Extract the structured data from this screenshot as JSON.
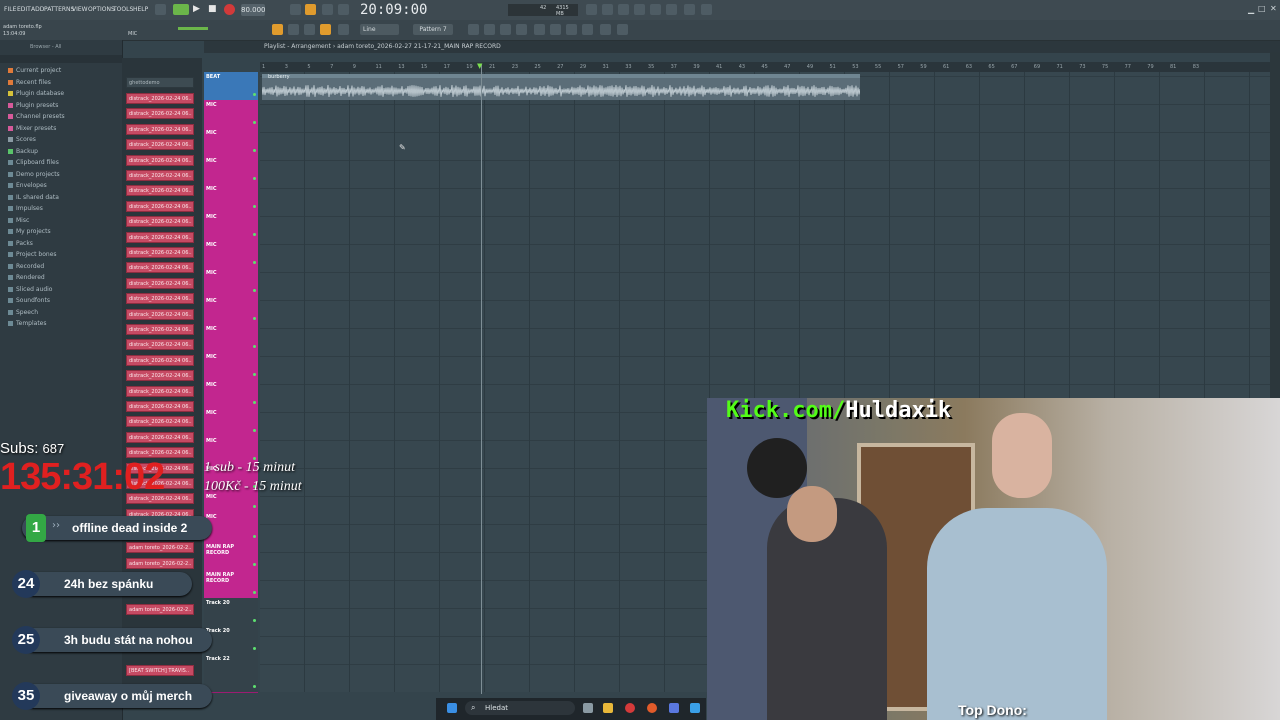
{
  "menu": [
    "FILE",
    "EDIT",
    "ADD",
    "PATTERNS",
    "VIEW",
    "OPTIONS",
    "TOOLS",
    "HELP"
  ],
  "transport": {
    "tempo": "80.000",
    "clock": "20:09:00",
    "pattern": "Pattern 7",
    "line_mode": "Line",
    "mic_label": "MIC",
    "cpu": "42",
    "mem": "4315 MB"
  },
  "project": {
    "name": "adam toreto.flp",
    "time": "13:04:09"
  },
  "browser": {
    "header": "Browser - All",
    "items": [
      "Current project",
      "Recent files",
      "Plugin database",
      "Plugin presets",
      "Channel presets",
      "Mixer presets",
      "Scores",
      "Backup",
      "Clipboard files",
      "Demo projects",
      "Envelopes",
      "IL shared data",
      "Impulses",
      "Misc",
      "My projects",
      "Packs",
      "Project bones",
      "Recorded",
      "Rendered",
      "Sliced audio",
      "Soundfonts",
      "Speech",
      "Templates"
    ]
  },
  "channels": {
    "first": "ghettodemo",
    "clip_label": "distrack_2026-02-24 06..",
    "bottom": [
      "adam toreto_2026-02-2..",
      "adam toreto_2026-02-2..",
      "adam toreto_2026-02-2..",
      "[BEAT SWITCH] TRAVIS.."
    ]
  },
  "playlist": {
    "title": "Playlist - Arrangement › adam toreto_2026-02-27 21-17-21_MAIN RAP RECORD",
    "clip_label": "burberry",
    "ruler": [
      "1",
      "3",
      "5",
      "7",
      "9",
      "11",
      "13",
      "15",
      "17",
      "19",
      "21",
      "23",
      "25",
      "27",
      "29",
      "31",
      "33",
      "35",
      "37",
      "39",
      "41",
      "43",
      "45",
      "47",
      "49",
      "51",
      "53",
      "55",
      "57",
      "59",
      "61",
      "63",
      "65",
      "67",
      "69",
      "71",
      "73",
      "75",
      "77",
      "79",
      "81",
      "83"
    ]
  },
  "tracks": {
    "beat": "BEAT",
    "mic": "MIC",
    "main": "MAIN RAP RECORD",
    "empty1": "Track 20",
    "empty2": "Track 22"
  },
  "overlay": {
    "subs_label": "Subs:",
    "subs_count": "687",
    "timer": "135:31:02",
    "rule1": "1 sub - 15 minut",
    "rule2": "100Kč - 15 minut",
    "goals": [
      {
        "num": "1",
        "text": "offline dead inside 2"
      },
      {
        "num": "24",
        "text": "24h bez spánku"
      },
      {
        "num": "25",
        "text": "3h budu stát na nohou"
      },
      {
        "num": "35",
        "text": "giveaway o můj merch"
      }
    ],
    "kick_prefix": "Kick.com/",
    "kick_name": "Huldaxik",
    "top_dono": "Top Dono:"
  },
  "taskbar": {
    "search": "Hledat"
  },
  "colors": {
    "accent": "#e09b2d",
    "track": "#c2268f",
    "clip": "#c64a63",
    "kick": "#53fc18",
    "timer": "#e02020"
  }
}
